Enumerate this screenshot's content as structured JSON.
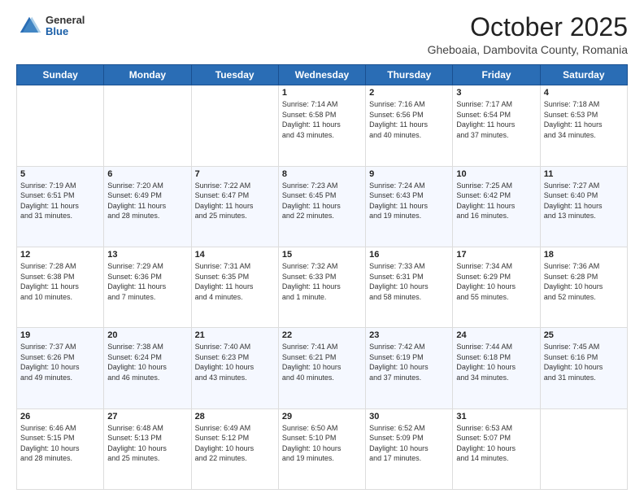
{
  "header": {
    "logo": {
      "line1": "General",
      "line2": "Blue"
    },
    "title": "October 2025",
    "subtitle": "Gheboaia, Dambovita County, Romania"
  },
  "days_of_week": [
    "Sunday",
    "Monday",
    "Tuesday",
    "Wednesday",
    "Thursday",
    "Friday",
    "Saturday"
  ],
  "weeks": [
    [
      {
        "day": "",
        "info": ""
      },
      {
        "day": "",
        "info": ""
      },
      {
        "day": "",
        "info": ""
      },
      {
        "day": "1",
        "info": "Sunrise: 7:14 AM\nSunset: 6:58 PM\nDaylight: 11 hours\nand 43 minutes."
      },
      {
        "day": "2",
        "info": "Sunrise: 7:16 AM\nSunset: 6:56 PM\nDaylight: 11 hours\nand 40 minutes."
      },
      {
        "day": "3",
        "info": "Sunrise: 7:17 AM\nSunset: 6:54 PM\nDaylight: 11 hours\nand 37 minutes."
      },
      {
        "day": "4",
        "info": "Sunrise: 7:18 AM\nSunset: 6:53 PM\nDaylight: 11 hours\nand 34 minutes."
      }
    ],
    [
      {
        "day": "5",
        "info": "Sunrise: 7:19 AM\nSunset: 6:51 PM\nDaylight: 11 hours\nand 31 minutes."
      },
      {
        "day": "6",
        "info": "Sunrise: 7:20 AM\nSunset: 6:49 PM\nDaylight: 11 hours\nand 28 minutes."
      },
      {
        "day": "7",
        "info": "Sunrise: 7:22 AM\nSunset: 6:47 PM\nDaylight: 11 hours\nand 25 minutes."
      },
      {
        "day": "8",
        "info": "Sunrise: 7:23 AM\nSunset: 6:45 PM\nDaylight: 11 hours\nand 22 minutes."
      },
      {
        "day": "9",
        "info": "Sunrise: 7:24 AM\nSunset: 6:43 PM\nDaylight: 11 hours\nand 19 minutes."
      },
      {
        "day": "10",
        "info": "Sunrise: 7:25 AM\nSunset: 6:42 PM\nDaylight: 11 hours\nand 16 minutes."
      },
      {
        "day": "11",
        "info": "Sunrise: 7:27 AM\nSunset: 6:40 PM\nDaylight: 11 hours\nand 13 minutes."
      }
    ],
    [
      {
        "day": "12",
        "info": "Sunrise: 7:28 AM\nSunset: 6:38 PM\nDaylight: 11 hours\nand 10 minutes."
      },
      {
        "day": "13",
        "info": "Sunrise: 7:29 AM\nSunset: 6:36 PM\nDaylight: 11 hours\nand 7 minutes."
      },
      {
        "day": "14",
        "info": "Sunrise: 7:31 AM\nSunset: 6:35 PM\nDaylight: 11 hours\nand 4 minutes."
      },
      {
        "day": "15",
        "info": "Sunrise: 7:32 AM\nSunset: 6:33 PM\nDaylight: 11 hours\nand 1 minute."
      },
      {
        "day": "16",
        "info": "Sunrise: 7:33 AM\nSunset: 6:31 PM\nDaylight: 10 hours\nand 58 minutes."
      },
      {
        "day": "17",
        "info": "Sunrise: 7:34 AM\nSunset: 6:29 PM\nDaylight: 10 hours\nand 55 minutes."
      },
      {
        "day": "18",
        "info": "Sunrise: 7:36 AM\nSunset: 6:28 PM\nDaylight: 10 hours\nand 52 minutes."
      }
    ],
    [
      {
        "day": "19",
        "info": "Sunrise: 7:37 AM\nSunset: 6:26 PM\nDaylight: 10 hours\nand 49 minutes."
      },
      {
        "day": "20",
        "info": "Sunrise: 7:38 AM\nSunset: 6:24 PM\nDaylight: 10 hours\nand 46 minutes."
      },
      {
        "day": "21",
        "info": "Sunrise: 7:40 AM\nSunset: 6:23 PM\nDaylight: 10 hours\nand 43 minutes."
      },
      {
        "day": "22",
        "info": "Sunrise: 7:41 AM\nSunset: 6:21 PM\nDaylight: 10 hours\nand 40 minutes."
      },
      {
        "day": "23",
        "info": "Sunrise: 7:42 AM\nSunset: 6:19 PM\nDaylight: 10 hours\nand 37 minutes."
      },
      {
        "day": "24",
        "info": "Sunrise: 7:44 AM\nSunset: 6:18 PM\nDaylight: 10 hours\nand 34 minutes."
      },
      {
        "day": "25",
        "info": "Sunrise: 7:45 AM\nSunset: 6:16 PM\nDaylight: 10 hours\nand 31 minutes."
      }
    ],
    [
      {
        "day": "26",
        "info": "Sunrise: 6:46 AM\nSunset: 5:15 PM\nDaylight: 10 hours\nand 28 minutes."
      },
      {
        "day": "27",
        "info": "Sunrise: 6:48 AM\nSunset: 5:13 PM\nDaylight: 10 hours\nand 25 minutes."
      },
      {
        "day": "28",
        "info": "Sunrise: 6:49 AM\nSunset: 5:12 PM\nDaylight: 10 hours\nand 22 minutes."
      },
      {
        "day": "29",
        "info": "Sunrise: 6:50 AM\nSunset: 5:10 PM\nDaylight: 10 hours\nand 19 minutes."
      },
      {
        "day": "30",
        "info": "Sunrise: 6:52 AM\nSunset: 5:09 PM\nDaylight: 10 hours\nand 17 minutes."
      },
      {
        "day": "31",
        "info": "Sunrise: 6:53 AM\nSunset: 5:07 PM\nDaylight: 10 hours\nand 14 minutes."
      },
      {
        "day": "",
        "info": ""
      }
    ]
  ]
}
